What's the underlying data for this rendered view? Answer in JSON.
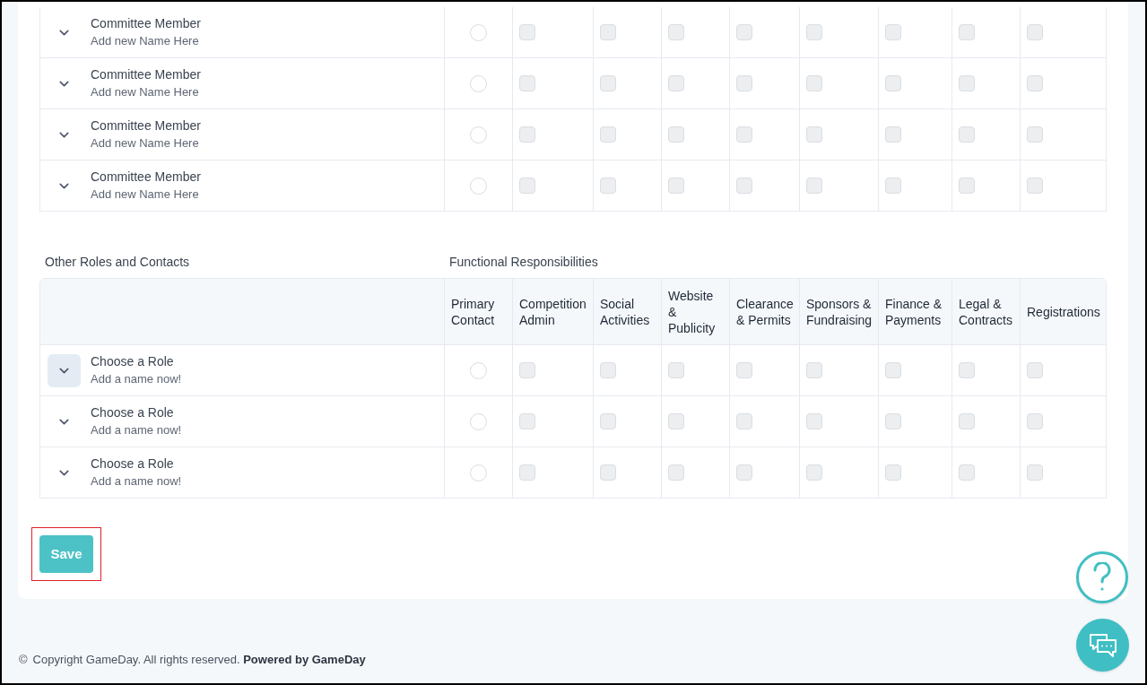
{
  "committee_rows": [
    {
      "role": "Committee Member",
      "subtitle": "Add new Name Here",
      "highlighted": false,
      "primary_contact": {
        "selected": false
      },
      "checks": [
        {
          "checked": false
        },
        {
          "checked": false
        },
        {
          "checked": false
        },
        {
          "checked": false
        },
        {
          "checked": false
        },
        {
          "checked": false
        },
        {
          "checked": false
        },
        {
          "checked": false
        }
      ]
    },
    {
      "role": "Committee Member",
      "subtitle": "Add new Name Here",
      "highlighted": false,
      "primary_contact": {
        "selected": false
      },
      "checks": [
        {
          "checked": false
        },
        {
          "checked": false
        },
        {
          "checked": false
        },
        {
          "checked": false
        },
        {
          "checked": false
        },
        {
          "checked": false
        },
        {
          "checked": false
        },
        {
          "checked": false
        }
      ]
    },
    {
      "role": "Committee Member",
      "subtitle": "Add new Name Here",
      "highlighted": false,
      "primary_contact": {
        "selected": false
      },
      "checks": [
        {
          "checked": false
        },
        {
          "checked": false
        },
        {
          "checked": false
        },
        {
          "checked": false
        },
        {
          "checked": false
        },
        {
          "checked": false
        },
        {
          "checked": false
        },
        {
          "checked": false
        }
      ]
    },
    {
      "role": "Committee Member",
      "subtitle": "Add new Name Here",
      "highlighted": false,
      "primary_contact": {
        "selected": false
      },
      "checks": [
        {
          "checked": false
        },
        {
          "checked": false
        },
        {
          "checked": false
        },
        {
          "checked": false
        },
        {
          "checked": false
        },
        {
          "checked": false
        },
        {
          "checked": false
        },
        {
          "checked": false
        }
      ]
    }
  ],
  "other_section": {
    "title": "Other Roles and Contacts",
    "functional_title": "Functional Responsibilities",
    "columns": [
      "Primary Contact",
      "Competition Admin",
      "Social Activities",
      "Website & Publicity",
      "Clearance & Permits",
      "Sponsors & Fundraising",
      "Finance & Payments",
      "Legal & Contracts",
      "Registrations"
    ],
    "rows": [
      {
        "role": "Choose a Role",
        "subtitle": "Add a name now!",
        "highlighted": true,
        "primary_contact": {
          "selected": false
        },
        "checks": [
          {
            "checked": false
          },
          {
            "checked": false
          },
          {
            "checked": false
          },
          {
            "checked": false
          },
          {
            "checked": false
          },
          {
            "checked": false
          },
          {
            "checked": false
          },
          {
            "checked": false
          }
        ]
      },
      {
        "role": "Choose a Role",
        "subtitle": "Add a name now!",
        "highlighted": false,
        "primary_contact": {
          "selected": false
        },
        "checks": [
          {
            "checked": false
          },
          {
            "checked": false
          },
          {
            "checked": false
          },
          {
            "checked": false
          },
          {
            "checked": false
          },
          {
            "checked": false
          },
          {
            "checked": false
          },
          {
            "checked": false
          }
        ]
      },
      {
        "role": "Choose a Role",
        "subtitle": "Add a name now!",
        "highlighted": false,
        "primary_contact": {
          "selected": false
        },
        "checks": [
          {
            "checked": false
          },
          {
            "checked": false
          },
          {
            "checked": false
          },
          {
            "checked": false
          },
          {
            "checked": false
          },
          {
            "checked": false
          },
          {
            "checked": false
          },
          {
            "checked": false
          }
        ]
      }
    ]
  },
  "save_button": {
    "label": "Save",
    "framed": true
  },
  "footer": {
    "symbol": "©",
    "text": "Copyright GameDay. All rights reserved. **Powered by GameDay**"
  }
}
